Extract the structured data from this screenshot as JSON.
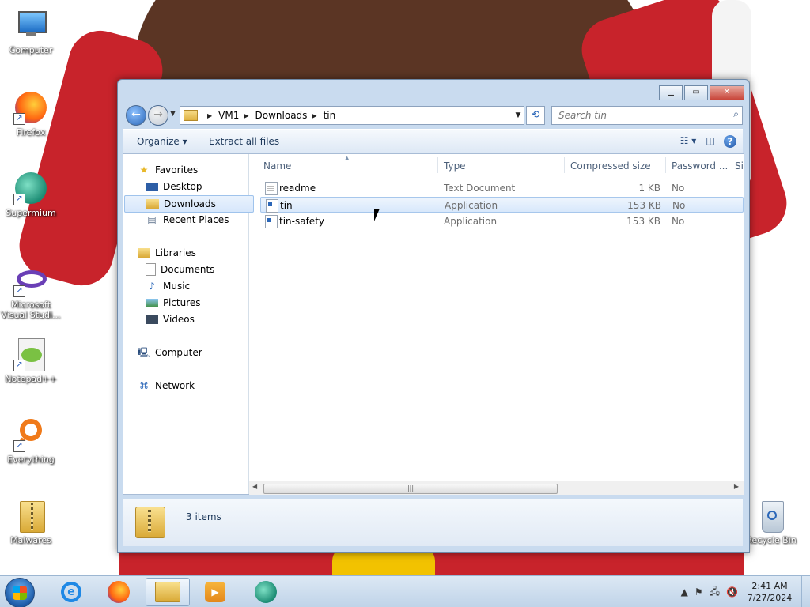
{
  "desktop": {
    "icons": [
      {
        "label": "Computer"
      },
      {
        "label": "Firefox"
      },
      {
        "label": "Supermium"
      },
      {
        "label": "Microsoft Visual Studi..."
      },
      {
        "label": "Notepad++"
      },
      {
        "label": "Everything"
      },
      {
        "label": "Malwares"
      },
      {
        "label": "Recycle Bin"
      }
    ]
  },
  "window": {
    "breadcrumb": [
      "VM1",
      "Downloads",
      "tin"
    ],
    "search_placeholder": "Search tin",
    "toolbar": {
      "organize": "Organize",
      "extract": "Extract all files"
    },
    "nav": {
      "favorites": "Favorites",
      "desktop": "Desktop",
      "downloads": "Downloads",
      "recent": "Recent Places",
      "libraries": "Libraries",
      "documents": "Documents",
      "music": "Music",
      "pictures": "Pictures",
      "videos": "Videos",
      "computer": "Computer",
      "network": "Network"
    },
    "columns": {
      "name": "Name",
      "type": "Type",
      "compressed": "Compressed size",
      "password": "Password ...",
      "size": "Si"
    },
    "files": [
      {
        "name": "readme",
        "type": "Text Document",
        "size": "1 KB",
        "password": "No"
      },
      {
        "name": "tin",
        "type": "Application",
        "size": "153 KB",
        "password": "No"
      },
      {
        "name": "tin-safety",
        "type": "Application",
        "size": "153 KB",
        "password": "No"
      }
    ],
    "status": "3 items"
  },
  "taskbar": {
    "time": "2:41 AM",
    "date": "7/27/2024"
  },
  "colors": {
    "accent": "#2a66b8",
    "selection": "#d8e8fb",
    "taskbar": "#bfd3e8"
  }
}
